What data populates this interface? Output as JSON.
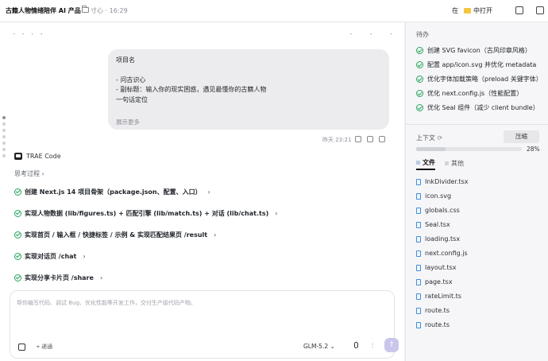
{
  "header": {
    "title": "古籍人物情绪陪伴 AI 产品",
    "folder": "寸心",
    "time": "16:29",
    "open_in_prefix": "在",
    "open_in_label": "中打开"
  },
  "chat": {
    "user_message": {
      "lines": [
        "项目名",
        "",
        "- 问古识心",
        "- 副标题：输入你的现实困惑，遇见最懂你的古籍人物",
        "一句话定位"
      ],
      "show_more": "展示更多",
      "time_label": "昨天 23:21"
    },
    "agent_name": "TRAE Code",
    "thinking_label": "思考过程",
    "tasks": [
      {
        "label": "创建 Next.js 14 项目骨架（package.json、配置、入口）"
      },
      {
        "label": "实现人物数据 (lib/figures.ts) + 匹配引擎 (lib/match.ts) + 对话 (lib/chat.ts)"
      },
      {
        "label": "实现首页 / 输入框 / 快捷标签 / 示例 & 实现匹配结果页 /result"
      },
      {
        "label": "实现对话页 /chat"
      },
      {
        "label": "实现分享卡片页 /share"
      }
    ]
  },
  "composer": {
    "placeholder": "帮你编写代码、调试 Bug、优化性能等开发工作，交付生产级代码产物。",
    "context_label": "递通",
    "model": "GLM-5.2",
    "send_icon": "arrow-up-icon"
  },
  "panel": {
    "todo_title": "待办",
    "todos": [
      "创建 SVG favicon（古风印章风格）",
      "配置 app/icon.svg 并优化 metadata",
      "优化字体加载策略（preload 关键字体）",
      "优化 next.config.js（性能配置）",
      "优化 Seal 组件（减少 client bundle）"
    ],
    "context_title": "上下文",
    "compress_label": "压缩",
    "usage_percent": 28,
    "usage_label": "28%",
    "tabs": [
      "文件",
      "其他"
    ],
    "files": [
      "InkDivider.tsx",
      "icon.svg",
      "globals.css",
      "Seal.tsx",
      "loading.tsx",
      "next.config.js",
      "layout.tsx",
      "page.tsx",
      "rateLimit.ts",
      "route.ts",
      "route.ts"
    ]
  }
}
